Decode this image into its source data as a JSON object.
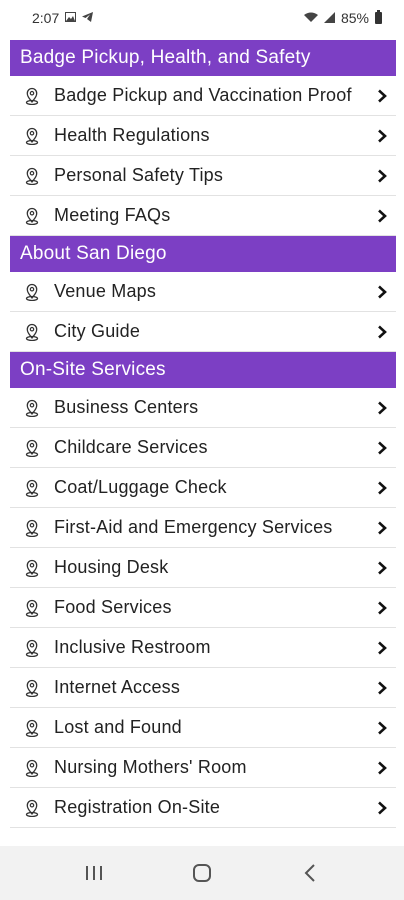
{
  "status_bar": {
    "time": "2:07",
    "battery": "85%",
    "icons": [
      "image-icon",
      "telegram-icon",
      "wifi-icon",
      "signal-icon",
      "battery-icon"
    ]
  },
  "sections": [
    {
      "title": "Badge Pickup, Health, and Safety",
      "items": [
        "Badge Pickup and Vaccination Proof",
        "Health Regulations",
        "Personal Safety Tips",
        "Meeting FAQs"
      ]
    },
    {
      "title": "About San Diego",
      "items": [
        "Venue Maps",
        "City Guide"
      ]
    },
    {
      "title": "On-Site Services",
      "items": [
        "Business Centers",
        "Childcare Services",
        "Coat/Luggage Check",
        "First-Aid and Emergency Services",
        "Housing Desk",
        "Food Services",
        "Inclusive Restroom",
        "Internet Access",
        "Lost and Found",
        "Nursing Mothers' Room",
        "Registration On-Site"
      ]
    }
  ],
  "row_icon": "map-pin-icon",
  "row_chevron": "chevron-right-icon",
  "nav_bar": {
    "buttons": [
      "recent-apps-icon",
      "home-icon",
      "back-icon"
    ]
  },
  "colors": {
    "section_header_bg": "#7c3fc4",
    "section_header_text": "#ffffff",
    "row_divider": "#e2e2e2",
    "nav_bar_bg": "#f2f2f2"
  }
}
